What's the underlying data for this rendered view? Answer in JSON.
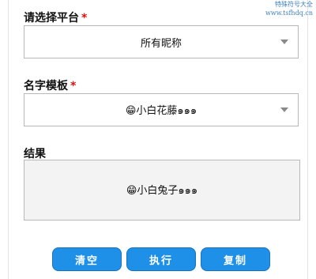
{
  "watermark": {
    "line1": "特殊符号大全",
    "line2": "www.tsfhdq.cn"
  },
  "platform": {
    "label": "请选择平台",
    "required_mark": "*",
    "value": "所有昵称"
  },
  "template": {
    "label": "名字模板",
    "required_mark": "*",
    "value": "😁小白花藤๑๑๑"
  },
  "result": {
    "label": "结果",
    "value": "😁小白兔子๑๑๑"
  },
  "buttons": {
    "clear": "清空",
    "run": "执行",
    "copy": "复制"
  },
  "colors": {
    "button_bg": "#1e90e8",
    "required": "#d11111",
    "watermark": "#3d7fc0"
  }
}
